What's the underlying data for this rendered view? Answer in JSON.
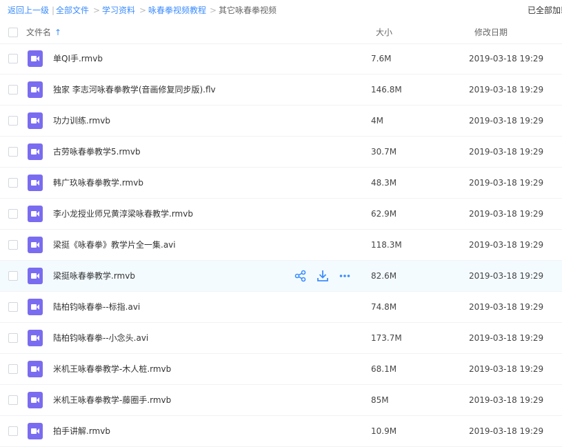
{
  "breadcrumb": {
    "back": "返回上一级",
    "divider": "|",
    "all_files": "全部文件",
    "sep": ">",
    "level1": "学习资料",
    "level2": "咏春拳视频教程",
    "current": "其它咏春拳视频",
    "status_right": "已全部加载"
  },
  "header": {
    "name": "文件名",
    "sort_arrow": "↑",
    "size": "大小",
    "modified": "修改日期"
  },
  "files": [
    {
      "name": "单QI手.rmvb",
      "size": "7.6M",
      "date": "2019-03-18 19:29"
    },
    {
      "name": "独家 李志河咏春拳教学(音画修复同步版).flv",
      "size": "146.8M",
      "date": "2019-03-18 19:29"
    },
    {
      "name": "功力训练.rmvb",
      "size": "4M",
      "date": "2019-03-18 19:29"
    },
    {
      "name": "古劳咏春拳教学5.rmvb",
      "size": "30.7M",
      "date": "2019-03-18 19:29"
    },
    {
      "name": "韩广玖咏春拳教学.rmvb",
      "size": "48.3M",
      "date": "2019-03-18 19:29"
    },
    {
      "name": "李小龙授业师兄黄淳梁咏春教学.rmvb",
      "size": "62.9M",
      "date": "2019-03-18 19:29"
    },
    {
      "name": "梁挺《咏春拳》教学片全一集.avi",
      "size": "118.3M",
      "date": "2019-03-18 19:29"
    },
    {
      "name": "梁挺咏春拳教学.rmvb",
      "size": "82.6M",
      "date": "2019-03-18 19:29"
    },
    {
      "name": "陆柏钧咏春拳--标指.avi",
      "size": "74.8M",
      "date": "2019-03-18 19:29"
    },
    {
      "name": "陆柏钧咏春拳--小念头.avi",
      "size": "173.7M",
      "date": "2019-03-18 19:29"
    },
    {
      "name": "米机王咏春拳教学-木人桩.rmvb",
      "size": "68.1M",
      "date": "2019-03-18 19:29"
    },
    {
      "name": "米机王咏春拳教学-藤圈手.rmvb",
      "size": "85M",
      "date": "2019-03-18 19:29"
    },
    {
      "name": "拍手讲解.rmvb",
      "size": "10.9M",
      "date": "2019-03-18 19:29"
    }
  ],
  "hover_row_index": 7,
  "row_actions": [
    "share-icon",
    "download-icon",
    "more-icon"
  ],
  "colors": {
    "accent": "#3b8cff",
    "video_icon": "#7a6cf0",
    "hover_bg": "#f4fbff"
  }
}
